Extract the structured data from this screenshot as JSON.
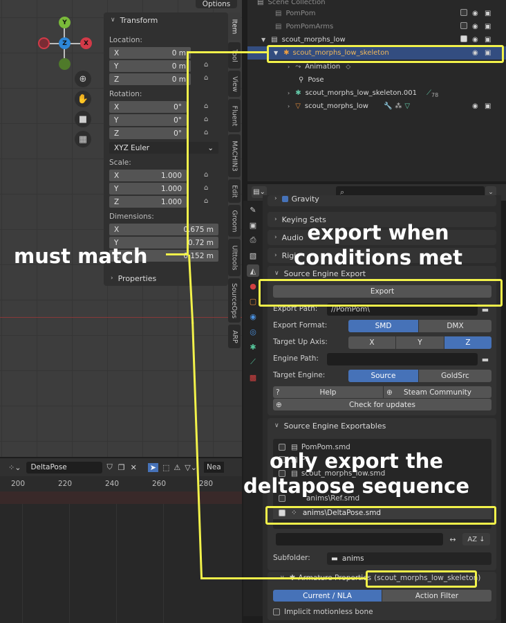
{
  "viewport": {
    "header_right": "Options",
    "gizmo": {
      "y": "Y",
      "z": "Z",
      "x": "X"
    }
  },
  "npanel": {
    "title": "Transform",
    "location_label": "Location:",
    "location": [
      {
        "axis": "X",
        "value": "0 m"
      },
      {
        "axis": "Y",
        "value": "0 m"
      },
      {
        "axis": "Z",
        "value": "0 m"
      }
    ],
    "rotation_label": "Rotation:",
    "rotation": [
      {
        "axis": "X",
        "value": "0°"
      },
      {
        "axis": "Y",
        "value": "0°"
      },
      {
        "axis": "Z",
        "value": "0°"
      }
    ],
    "rotation_mode": "XYZ Euler",
    "scale_label": "Scale:",
    "scale": [
      {
        "axis": "X",
        "value": "1.000"
      },
      {
        "axis": "Y",
        "value": "1.000"
      },
      {
        "axis": "Z",
        "value": "1.000"
      }
    ],
    "dimensions_label": "Dimensions:",
    "dimensions": [
      {
        "axis": "X",
        "value": "0.675 m"
      },
      {
        "axis": "Y",
        "value": "0.72 m"
      },
      {
        "axis": "Z",
        "value": "0.152 m"
      }
    ],
    "properties_label": "Properties"
  },
  "side_tabs": [
    "Item",
    "Tool",
    "View",
    "Fluent",
    "MACHIN3",
    "Edit",
    "Groom",
    "Ulttools",
    "SourceOps",
    "ARP"
  ],
  "timeline": {
    "action_name": "DeltaPose",
    "near_label": "Nea",
    "ticks": [
      "200",
      "220",
      "240",
      "260",
      "280"
    ]
  },
  "outliner": {
    "header": "Scene Collection",
    "rows": [
      {
        "name": "PomPom"
      },
      {
        "name": "PomPomArms"
      },
      {
        "name": "scout_morphs_low"
      },
      {
        "name": "scout_morphs_low_skeleton"
      },
      {
        "name": "Animation"
      },
      {
        "name": "Pose"
      },
      {
        "name": "scout_morphs_low_skeleton.001",
        "badge": "78"
      },
      {
        "name": "scout_morphs_low"
      }
    ]
  },
  "properties": {
    "gravity": "Gravity",
    "keying_sets": "Keying Sets",
    "audio": "Audio",
    "rigid": "Rigi",
    "source_engine_export": "Source Engine Export",
    "export_button": "Export",
    "export_path_label": "Export Path:",
    "export_path_value": "//PomPom\\",
    "export_format_label": "Export Format:",
    "format_options": [
      "SMD",
      "DMX"
    ],
    "up_axis_label": "Target Up Axis:",
    "axis_options": [
      "X",
      "Y",
      "Z"
    ],
    "engine_path_label": "Engine Path:",
    "target_engine_label": "Target Engine:",
    "engine_options": [
      "Source",
      "GoldSrc"
    ],
    "help": "Help",
    "steam_community": "Steam Community",
    "check_updates": "Check for updates",
    "exportables_title": "Source Engine Exportables",
    "exportables": [
      "PomPom.smd",
      "PomPomArms.smd",
      "scout_morphs_low.smd",
      "anims\\Ref.smd",
      "anims\\DeltaPose.smd"
    ],
    "exportable_partial_1": "Po",
    "subfolder_label": "Subfolder:",
    "subfolder_value": "anims",
    "armature_label": "Armature Properties",
    "armature_value": "(scout_morphs_low_skeleton)",
    "current_nla": "Current / NLA",
    "action_filter": "Action Filter",
    "implicit_bone": "Implicit motionless bone"
  },
  "annotations": {
    "must_match": "must match",
    "export_when": "export when\nconditions met",
    "only_export": "only export the\ndeltapose sequence"
  },
  "colors": {
    "annotation": "#f2f24a",
    "accent_blue": "#4672b8",
    "selection": "#334d80"
  }
}
